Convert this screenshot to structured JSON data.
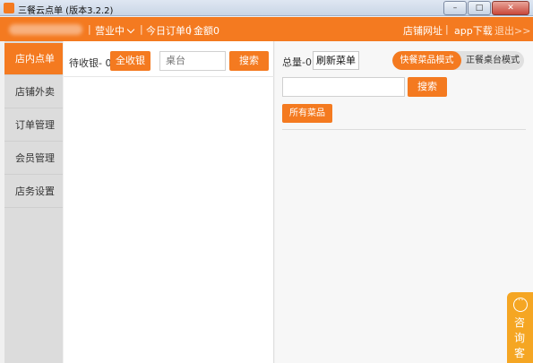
{
  "window": {
    "title": "三餐云点单 (版本3.2.2)",
    "controls": [
      "–",
      "□",
      "✕"
    ]
  },
  "topbar": {
    "status_label": "营业中",
    "today_orders": "今日订单0",
    "amount": "金额0",
    "store_url": "店铺网址",
    "app_download": "app下载",
    "logout": "退出>>"
  },
  "sidebar": {
    "items": [
      {
        "label": "店内点单",
        "active": true
      },
      {
        "label": "店铺外卖"
      },
      {
        "label": "订单管理"
      },
      {
        "label": "会员管理"
      },
      {
        "label": "店务设置"
      }
    ]
  },
  "middle": {
    "pending_label": "待收银- 0",
    "checkout_all": "全收银",
    "table_placeholder": "桌台",
    "search": "搜索"
  },
  "right": {
    "total_label": "总量-0",
    "refresh_menu": "刷新菜单",
    "mode_fast": "快餐菜品模式",
    "mode_table": "正餐桌台模式",
    "search": "搜索",
    "all_dishes": "所有菜品"
  },
  "consult": {
    "label": "咨询客服"
  },
  "colors": {
    "accent": "#f47a20",
    "consult": "#f5a623"
  }
}
